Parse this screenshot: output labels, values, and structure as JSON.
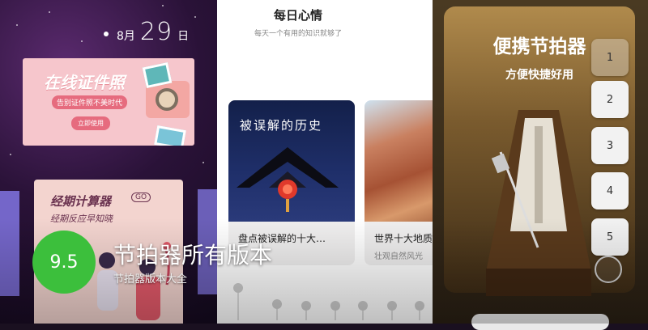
{
  "panel1": {
    "date_month": "8月",
    "date_day": "29",
    "date_suffix": "日",
    "photo_card": {
      "title": "在线证件照",
      "subtitle": "告别证件照不美时代",
      "button": "立即使用"
    },
    "period_card": {
      "title": "经期计算器",
      "badge": "GO",
      "subtitle": "经期反应早知晓"
    }
  },
  "panel2": {
    "title": "每日心情",
    "subtitle": "每天一个有用的知识就够了",
    "tiles": [
      {
        "overlay": "被误解的历史",
        "caption": "盘点被误解的十大…",
        "caption2": ""
      },
      {
        "overlay": "",
        "caption": "世界十大地质",
        "caption2": "壮观自然风光"
      }
    ]
  },
  "panel3": {
    "title": "便携节拍器",
    "subtitle": "方便快捷好用",
    "beat_buttons": [
      "1",
      "2",
      "3",
      "4",
      "5"
    ]
  },
  "overlay": {
    "score": "9.5",
    "app_name": "节拍器所有版本",
    "app_desc": "节拍器版本大全"
  },
  "colors": {
    "score_green": "#3cbf3c",
    "panel3_gold": "#b08a4c"
  }
}
